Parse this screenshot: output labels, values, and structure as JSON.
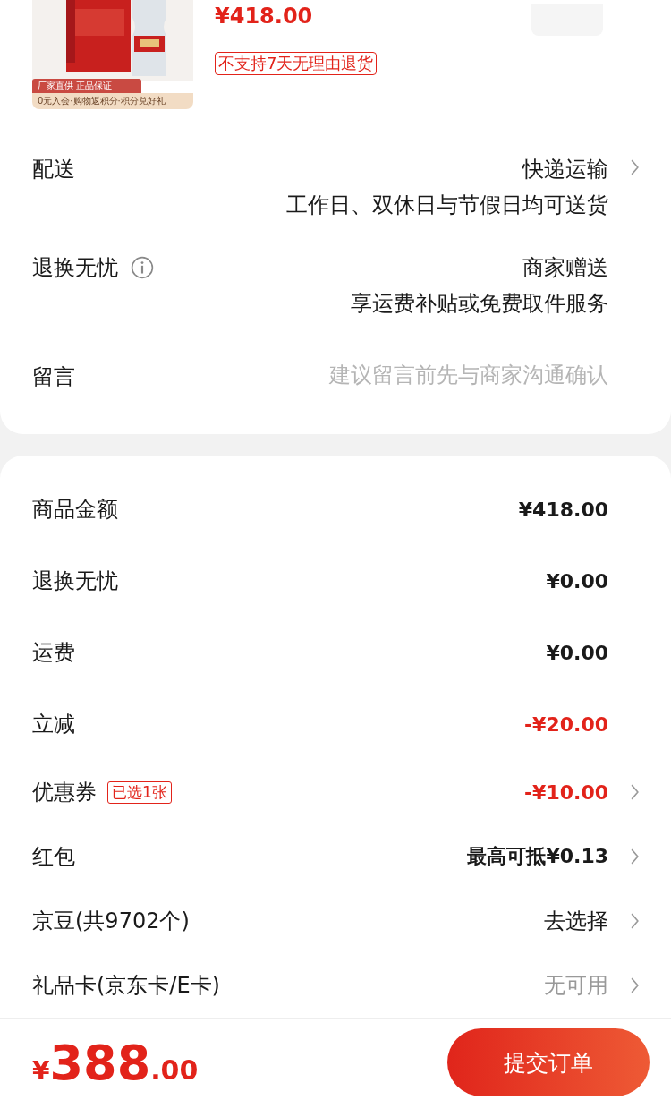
{
  "product": {
    "image": {
      "kind": "picture",
      "banner": "厂家直供 正品保证",
      "promo": "0元入会·购物返积分·积分兑好礼"
    },
    "price": "¥418.00",
    "tag": "不支持7天无理由退货"
  },
  "options": [
    {
      "label": "配送",
      "info": false,
      "lines": [
        "快递运输",
        "工作日、双休日与节假日均可送货"
      ],
      "arrow": true
    },
    {
      "label": "退换无忧",
      "info": true,
      "lines": [
        "商家赠送",
        "享运费补贴或免费取件服务"
      ],
      "arrow": false
    },
    {
      "label": "留言",
      "info": false,
      "placeholder": "建议留言前先与商家沟通确认",
      "arrow": false
    }
  ],
  "summary": [
    {
      "label": "商品金额",
      "value": "¥418.00",
      "kind": "amount",
      "arrow": false
    },
    {
      "label": "退换无忧",
      "value": "¥0.00",
      "kind": "amount",
      "arrow": false
    },
    {
      "label": "运费",
      "value": "¥0.00",
      "kind": "amount",
      "arrow": false
    },
    {
      "label": "立减",
      "value": "-¥20.00",
      "kind": "discount",
      "arrow": false
    },
    {
      "label": "优惠券",
      "badge": "已选1张",
      "value": "-¥10.00",
      "kind": "discount",
      "arrow": true
    },
    {
      "label": "红包",
      "value": "最高可抵¥0.13",
      "kind": "amount",
      "arrow": true
    },
    {
      "label": "京豆(共9702个)",
      "value": "去选择",
      "kind": "choice",
      "arrow": true
    },
    {
      "label": "礼品卡(京东卡/E卡)",
      "value": "无可用",
      "kind": "unavailable",
      "arrow": true
    }
  ],
  "footer": {
    "currency": "¥",
    "amount": "388",
    "decimals": ".00",
    "submit": "提交订单"
  }
}
